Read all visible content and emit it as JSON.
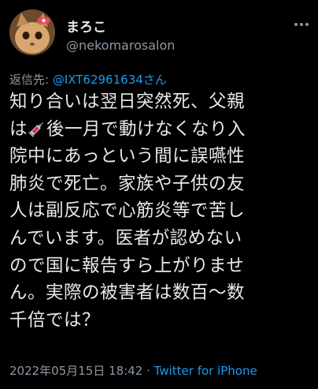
{
  "author": {
    "display_name": "まろこ",
    "handle": "@nekomarosalon",
    "avatar_icon": "cat-avatar-icon"
  },
  "reply": {
    "prefix": "返信先: ",
    "mention": "@IXT62961634さん"
  },
  "body": {
    "lines": [
      "知り合いは翌日突然死、父親",
      "後一月で動けなくなり入",
      "院中にあっという間に誤嚥性",
      "肺炎で死亡。家族や子供の友",
      "人は副反応で心筋炎等で苦し",
      "んでいます。医者が認めない",
      "ので国に報告すら上がりませ",
      "ん。実際の被害者は数百〜数",
      "千倍では？"
    ],
    "line2_prefix": "は",
    "line2_emoji": "syringe-icon"
  },
  "meta": {
    "timestamp": "2022年05月15日 18:42",
    "separator": " · ",
    "source": "Twitter for iPhone"
  },
  "colors": {
    "background": "#000000",
    "text": "#e7e9ea",
    "secondary": "#8b98a5",
    "accent": "#1d9bf0"
  }
}
